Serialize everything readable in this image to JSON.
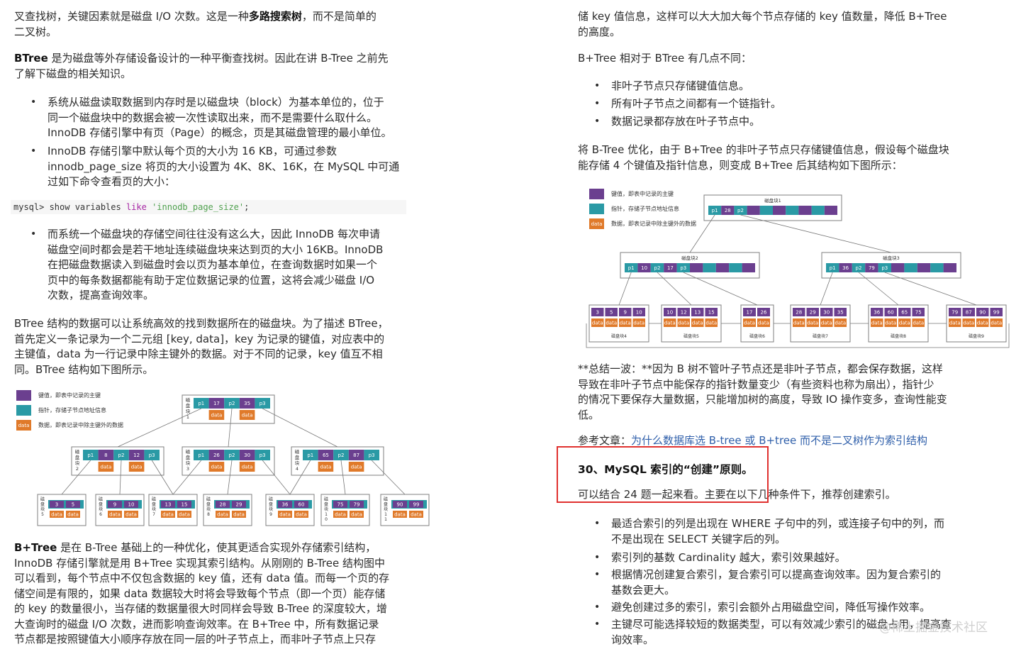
{
  "left": {
    "p1": [
      "叉查找树，关键因素就是磁盘 I/O 次数。这是一种",
      "多路搜索树",
      "，而不是简单的",
      "二叉树。"
    ],
    "p2": [
      "BTree",
      " 是为磁盘等外存储设备设计的一种平衡查找树。因此在讲 B-Tree 之前先",
      "了解下磁盘的相关知识。"
    ],
    "bullets1": [
      [
        "系统从磁盘读取数据到内存时是以磁盘块（block）为基本单位的，位于",
        "同一个磁盘块中的数据会被一次性读取出来，而不是需要什么取什么。",
        "InnoDB 存储引擎中有页（Page）的概念，页是其磁盘管理的最小单位。"
      ],
      [
        "InnoDB 存储引擎中默认每个页的大小为 16 KB，可通过参数",
        "innodb_page_size 将页的大小设置为 4K、8K、16K，在 MySQL 中可通",
        "过如下命令查看页的大小："
      ]
    ],
    "code": {
      "prefix": "mysql> show variables ",
      "kw": "like",
      "str": " 'innodb_page_size'",
      "suffix": ";"
    },
    "bullets2": [
      [
        "而系统一个磁盘块的存储空间往往没有这么大，因此 InnoDB 每次申请",
        "磁盘空间时都会是若干地址连续磁盘块来达到页的大小 16KB。InnoDB",
        "在把磁盘数据读入到磁盘时会以页为基本单位，在查询数据时如果一个",
        "页中的每条数据都能有助于定位数据记录的位置，这将会减少磁盘 I/O",
        "次数，提高查询效率。"
      ]
    ],
    "p3": [
      "BTree 结构的数据可以让系统高效的找到数据所在的磁盘块。为了描述 BTree，",
      "首先定义一条记录为一个二元组 [key, data]，key 为记录的键值，对应表中的",
      "主键值，data 为一行记录中除主键外的数据。对于不同的记录，key 值互不相",
      "同。BTree 结构如下图所示。"
    ],
    "legend": [
      "键值，即表中记录的主键",
      "指针，存储子节点地址信息",
      "数据，即表记录中除主键外的数据"
    ],
    "p4": [
      "B+Tree",
      " 是在 B-Tree 基础上的一种优化，使其更适合实现外存储索引结构，",
      "InnoDB 存储引擎就是用 B+Tree 实现其索引结构。从刚刚的 B-Tree 结构图中",
      "可以看到，每个节点中不仅包含数据的 key 值，还有 data 值。而每一个页的存",
      "储空间是有限的，如果 data 数据较大时将会导致每个节点（即一个页）能存储",
      "的 key 的数量很小，当存储的数据量很大时同样会导致 B-Tree 的深度较大，增",
      "大查询时的磁盘 I/O 次数，进而影响查询效率。在 B+Tree 中，所有数据记录",
      "节点都是按照键值大小顺序存放在同一层的叶子节点上，而非叶子节点上只存"
    ]
  },
  "right": {
    "p1": [
      "储 key 值信息，这样可以大大加大每个节点存储的 key 值数量，降低 B+Tree",
      "的高度。"
    ],
    "p2": "B+Tree 相对于 BTree 有几点不同：",
    "bullets1": [
      "非叶子节点只存储键值信息。",
      "所有叶子节点之间都有一个链指针。",
      "数据记录都存放在叶子节点中。"
    ],
    "p3": [
      "将 B-Tree 优化，由于 B+Tree 的非叶子节点只存储键值信息，假设每个磁盘块",
      "能存储 4 个键值及指针信息，则变成 B+Tree 后其结构如下图所示："
    ],
    "legend": [
      "键值，即表中记录的主键",
      "指针，存储子节点地址信息",
      "数据，即表记录中除主键外的数据"
    ],
    "p4": [
      "**总结一波：**因为 B 树不管叶子节点还是非叶子节点，都会保存数据，这样",
      "导致在非叶子节点中能保存的指针数量变少（有些资料也称为扇出），指针少",
      "的情况下要保存大量数据，只能增加树的高度，导致 IO 操作变多，查询性能变",
      "低。"
    ],
    "ref_label": "参考文章：",
    "ref_link": "为什么数据库选 B-tree 或 B+tree 而不是二叉树作为索引结构",
    "heading": "30、MySQL 索引的“创建”原则。",
    "p5": "可以结合 24 题一起来看。主要在以下几种条件下，推荐创建索引。",
    "bullets2": [
      [
        "最适合索引的列是出现在 WHERE 子句中的列，或连接子句中的列，而",
        "不是出现在 SELECT 关键字后的列。"
      ],
      [
        "索引列的基数 Cardinality 越大，索引效果越好。"
      ],
      [
        "根据情况创建复合索引，复合索引可以提高查询效率。因为复合索引的",
        "基数会更大。"
      ],
      [
        "避免创建过多的索引，索引会额外占用磁盘空间，降低写操作效率。"
      ],
      [
        "主键尽可能选择较短的数据类型，可以有效减少索引的磁盘占用，提高查",
        "询效率。"
      ]
    ],
    "watermark": "@稀土掘金技术社区"
  },
  "btree": {
    "data_label": "data",
    "root": {
      "label": "磁盘块1",
      "keys": [
        "17",
        "35"
      ]
    },
    "level2": [
      {
        "label": "磁盘块2",
        "keys": [
          "8",
          "12"
        ]
      },
      {
        "label": "磁盘块3",
        "keys": [
          "26",
          "30"
        ]
      },
      {
        "label": "磁盘块4",
        "keys": [
          "65",
          "87"
        ]
      }
    ],
    "leaves": [
      {
        "label": "磁盘块5",
        "keys": [
          "3",
          "5"
        ]
      },
      {
        "label": "磁盘块6",
        "keys": [
          "9",
          "10"
        ]
      },
      {
        "label": "磁盘块7",
        "keys": [
          "13",
          "15"
        ]
      },
      {
        "label": "磁盘块8",
        "keys": [
          "28",
          "29"
        ]
      },
      {
        "label": "磁盘块9",
        "keys": [
          "36",
          "60"
        ]
      },
      {
        "label": "磁盘块10",
        "keys": [
          "75",
          "79"
        ]
      },
      {
        "label": "磁盘块11",
        "keys": [
          "90",
          "99"
        ]
      }
    ],
    "ptr": [
      "p1",
      "p2",
      "p3"
    ]
  },
  "bplus": {
    "data_label": "data",
    "root": {
      "label": "磁盘块1",
      "keys": [
        "28"
      ],
      "ptrs": [
        "p1",
        "p2"
      ]
    },
    "level2": [
      {
        "label": "磁盘块2",
        "keys": [
          "10",
          "17"
        ],
        "ptrs": [
          "p1",
          "p2",
          "p3"
        ]
      },
      {
        "label": "磁盘块3",
        "keys": [
          "36",
          "79"
        ],
        "ptrs": [
          "p1",
          "p2",
          "p3"
        ]
      }
    ],
    "leaves": [
      {
        "label": "磁盘块4",
        "keys": [
          "3",
          "5",
          "9",
          "10"
        ]
      },
      {
        "label": "磁盘块5",
        "keys": [
          "10",
          "12",
          "13",
          "15"
        ]
      },
      {
        "label": "磁盘块6",
        "keys": [
          "17",
          "26"
        ]
      },
      {
        "label": "磁盘块7",
        "keys": [
          "28",
          "29",
          "30",
          "35"
        ]
      },
      {
        "label": "磁盘块8",
        "keys": [
          "36",
          "60",
          "65",
          "75"
        ]
      },
      {
        "label": "磁盘块9",
        "keys": [
          "79",
          "87",
          "90",
          "99"
        ]
      }
    ]
  },
  "colors": {
    "key": "#6b3f8f",
    "ptr": "#2a9aa5",
    "data": "#e07a2a",
    "box": "#7f7f7f"
  }
}
